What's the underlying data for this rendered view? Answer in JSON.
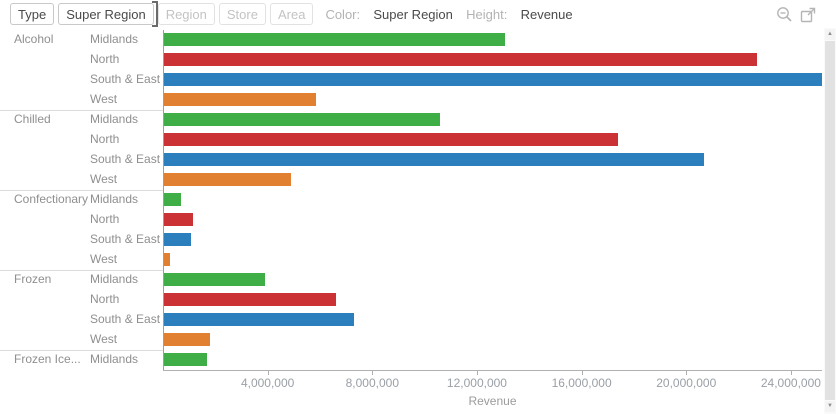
{
  "toolbar": {
    "levels": [
      {
        "label": "Type",
        "state": "enabled"
      },
      {
        "label": "Super Region",
        "state": "active"
      },
      {
        "label": "Region",
        "state": "disabled"
      },
      {
        "label": "Store",
        "state": "disabled"
      },
      {
        "label": "Area",
        "state": "disabled"
      }
    ],
    "color_label": "Color:",
    "color_value": "Super Region",
    "height_label": "Height:",
    "height_value": "Revenue",
    "icons": [
      "zoom-out-icon",
      "export-icon"
    ],
    "icon_color": "#b5b5b5"
  },
  "chart_data": {
    "type": "bar",
    "orientation": "horizontal",
    "xlabel": "Revenue",
    "xlim": [
      0,
      25150000
    ],
    "x_tick_values": [
      4000000,
      8000000,
      12000000,
      16000000,
      20000000,
      24000000
    ],
    "x_tick_labels": [
      "4,000,000",
      "8,000,000",
      "12,000,000",
      "16,000,000",
      "20,000,000",
      "24,000,000"
    ],
    "grid": false,
    "legend_position": "none",
    "series_colors": {
      "Midlands": "#3fae46",
      "North": "#ca3236",
      "South & East": "#2b7fbd",
      "West": "#e08030"
    },
    "groups": [
      {
        "category": "Alcohol",
        "rows": [
          {
            "region": "Midlands",
            "value": 13050000
          },
          {
            "region": "North",
            "value": 22650000
          },
          {
            "region": "South & East",
            "value": 25150000
          },
          {
            "region": "West",
            "value": 5800000
          }
        ]
      },
      {
        "category": "Chilled",
        "rows": [
          {
            "region": "Midlands",
            "value": 10550000
          },
          {
            "region": "North",
            "value": 17350000
          },
          {
            "region": "South & East",
            "value": 20650000
          },
          {
            "region": "West",
            "value": 4850000
          }
        ]
      },
      {
        "category": "Confectionary",
        "rows": [
          {
            "region": "Midlands",
            "value": 650000
          },
          {
            "region": "North",
            "value": 1100000
          },
          {
            "region": "South & East",
            "value": 1050000
          },
          {
            "region": "West",
            "value": 220000
          }
        ]
      },
      {
        "category": "Frozen",
        "rows": [
          {
            "region": "Midlands",
            "value": 3870000
          },
          {
            "region": "North",
            "value": 6570000
          },
          {
            "region": "South & East",
            "value": 7270000
          },
          {
            "region": "West",
            "value": 1750000
          }
        ]
      },
      {
        "category": "Frozen Ice...",
        "rows": [
          {
            "region": "Midlands",
            "value": 1650000
          }
        ]
      }
    ]
  }
}
